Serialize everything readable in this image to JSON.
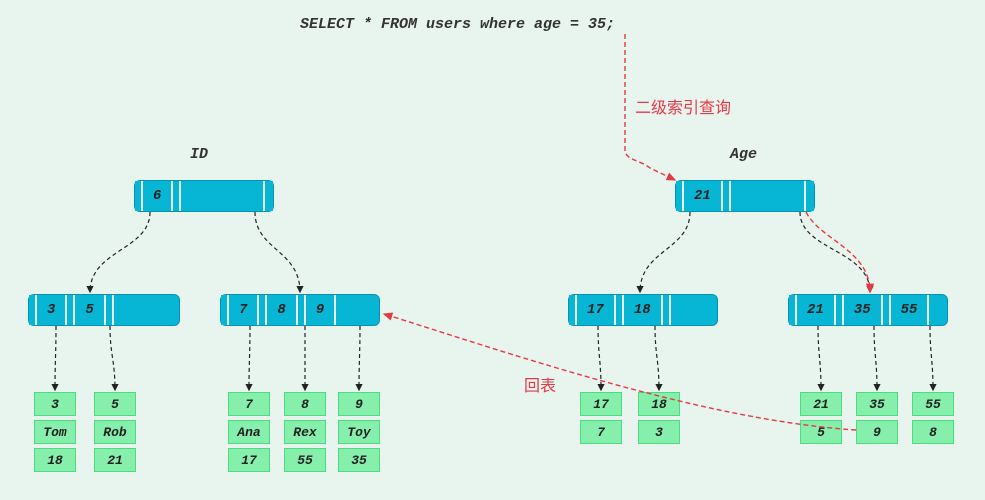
{
  "sql": "SELECT * FROM users where age = 35;",
  "annotations": {
    "secondary_index_lookup": "二级索引查询",
    "back_to_table": "回表"
  },
  "left_tree": {
    "label": "ID",
    "root": [
      "6"
    ],
    "children": [
      {
        "vals": [
          "3",
          "5"
        ]
      },
      {
        "vals": [
          "7",
          "8",
          "9"
        ]
      }
    ],
    "leaves": [
      {
        "key": "3",
        "name": "Tom",
        "extra": "18"
      },
      {
        "key": "5",
        "name": "Rob",
        "extra": "21"
      },
      {
        "key": "7",
        "name": "Ana",
        "extra": "17"
      },
      {
        "key": "8",
        "name": "Rex",
        "extra": "55"
      },
      {
        "key": "9",
        "name": "Toy",
        "extra": "35"
      }
    ]
  },
  "right_tree": {
    "label": "Age",
    "root": [
      "21"
    ],
    "children": [
      {
        "vals": [
          "17",
          "18"
        ]
      },
      {
        "vals": [
          "21",
          "35",
          "55"
        ]
      }
    ],
    "leaves": [
      {
        "key": "17",
        "ptr": "7"
      },
      {
        "key": "18",
        "ptr": "3"
      },
      {
        "key": "21",
        "ptr": "5"
      },
      {
        "key": "35",
        "ptr": "9"
      },
      {
        "key": "55",
        "ptr": "8"
      }
    ]
  },
  "chart_data": {
    "type": "diagram",
    "description": "Two B+ tree indexes (primary key ID and secondary index Age) illustrating secondary-index lookup then back-to-table (回表) operation for SQL: SELECT * FROM users where age = 35;",
    "primary_index": {
      "column": "ID",
      "root_keys": [
        6
      ],
      "internal_nodes": [
        [
          3,
          5
        ],
        [
          7,
          8,
          9
        ]
      ],
      "leaf_rows": [
        {
          "id": 3,
          "name": "Tom",
          "age": 18
        },
        {
          "id": 5,
          "name": "Rob",
          "age": 21
        },
        {
          "id": 7,
          "name": "Ana",
          "age": 17
        },
        {
          "id": 8,
          "name": "Rex",
          "age": 55
        },
        {
          "id": 9,
          "name": "Toy",
          "age": 35
        }
      ]
    },
    "secondary_index": {
      "column": "Age",
      "root_keys": [
        21
      ],
      "internal_nodes": [
        [
          17,
          18
        ],
        [
          21,
          35,
          55
        ]
      ],
      "leaf_entries": [
        {
          "age": 17,
          "id": 7
        },
        {
          "age": 18,
          "id": 3
        },
        {
          "age": 21,
          "id": 5
        },
        {
          "age": 35,
          "id": 9
        },
        {
          "age": 55,
          "id": 8
        }
      ]
    },
    "lookup_path": {
      "step1_secondary_index": [
        21,
        35
      ],
      "step2_found_id": 9,
      "step3_back_to_primary": [
        6,
        9
      ]
    }
  }
}
